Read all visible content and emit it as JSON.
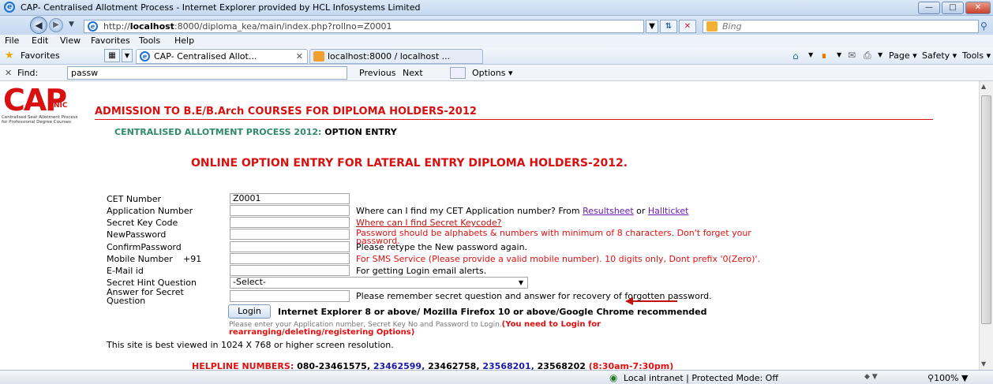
{
  "window": {
    "title": "CAP- Centralised Allotment Process - Internet Explorer provided by HCL Infosystems Limited"
  },
  "nav": {
    "url_prefix": "http://",
    "url_host": "localhost",
    "url_rest": ":8000/diploma_kea/main/index.php?rollno=Z0001",
    "search_placeholder": "Bing"
  },
  "menu": [
    "File",
    "Edit",
    "View",
    "Favorites",
    "Tools",
    "Help"
  ],
  "favorites_label": "Favorites",
  "tabs": [
    "CAP- Centralised Allot...",
    "localhost:8000 / localhost ..."
  ],
  "command_bar": {
    "page": "Page",
    "safety": "Safety",
    "tools": "Tools"
  },
  "find": {
    "label": "Find:",
    "value": "passw",
    "previous": "Previous",
    "next": "Next",
    "options": "Options"
  },
  "logo": {
    "text": "CAP",
    "nic": "NIC",
    "tag1": "Centralised Seat Allotment Process",
    "tag2": "for Professional Degree Courses"
  },
  "header": {
    "title": "ADMISSION TO B.E/B.Arch COURSES FOR DIPLOMA HOLDERS-2012",
    "sub_label": "CENTRALISED ALLOTMENT PROCESS 2012:",
    "sub_value": "OPTION ENTRY",
    "page_title": "ONLINE OPTION ENTRY FOR LATERAL ENTRY DIPLOMA HOLDERS-2012."
  },
  "form": {
    "cet_label": "CET Number",
    "cet_value": "Z0001",
    "app_label": "Application Number",
    "app_hint": "Where can I find my CET Application number? From ",
    "app_link1": "Resultsheet",
    "app_or": " or ",
    "app_link2": "Hallticket",
    "key_label": "Secret Key Code",
    "key_link": "Where can I find Secret Keycode?",
    "pw_label": "NewPassword",
    "pw_hint1": "Password should be alphabets & numbers with minimum of 8 characters. Don't forget your",
    "pw_hint2": "password.",
    "cpw_label": "ConfirmPassword",
    "cpw_hint": "Please retype the New password again.",
    "mob_label": "Mobile Number",
    "mob_prefix": "+91",
    "mob_hint": "For SMS Service (Please provide a valid mobile number). 10 digits only, Dont prefix '0(Zero)'.",
    "email_label": "E-Mail id",
    "email_hint": "For getting Login email alerts.",
    "hint_q_label": "Secret Hint Question",
    "hint_q_value": "-Select-",
    "ans_label1": "Answer for Secret",
    "ans_label2": "Question",
    "ans_hint": "Please remember secret question and answer for recovery of forgotten password.",
    "login": "Login",
    "browser_note": "Internet Explorer 8 or above/ Mozilla Firefox 10 or above/Google Chrome recommended",
    "note_gray": "Please enter your Application number, Secret Key No and Password to Login.",
    "note_red1": "(You need to Login for",
    "note_red2": "rearranging/deleting/registering Options)",
    "resolution": "This site is best viewed in 1024 X 768 or higher screen resolution."
  },
  "helpline": {
    "label": "HELPLINE NUMBERS:",
    "n1": "080-23461575,",
    "n2": "23462599,",
    "n3": "23462758,",
    "n4": "23568201,",
    "n5": "23568202",
    "hours": "(8:30am-7:30pm)"
  },
  "status": {
    "zone": "Local intranet | Protected Mode: Off",
    "zoom": "100%"
  }
}
